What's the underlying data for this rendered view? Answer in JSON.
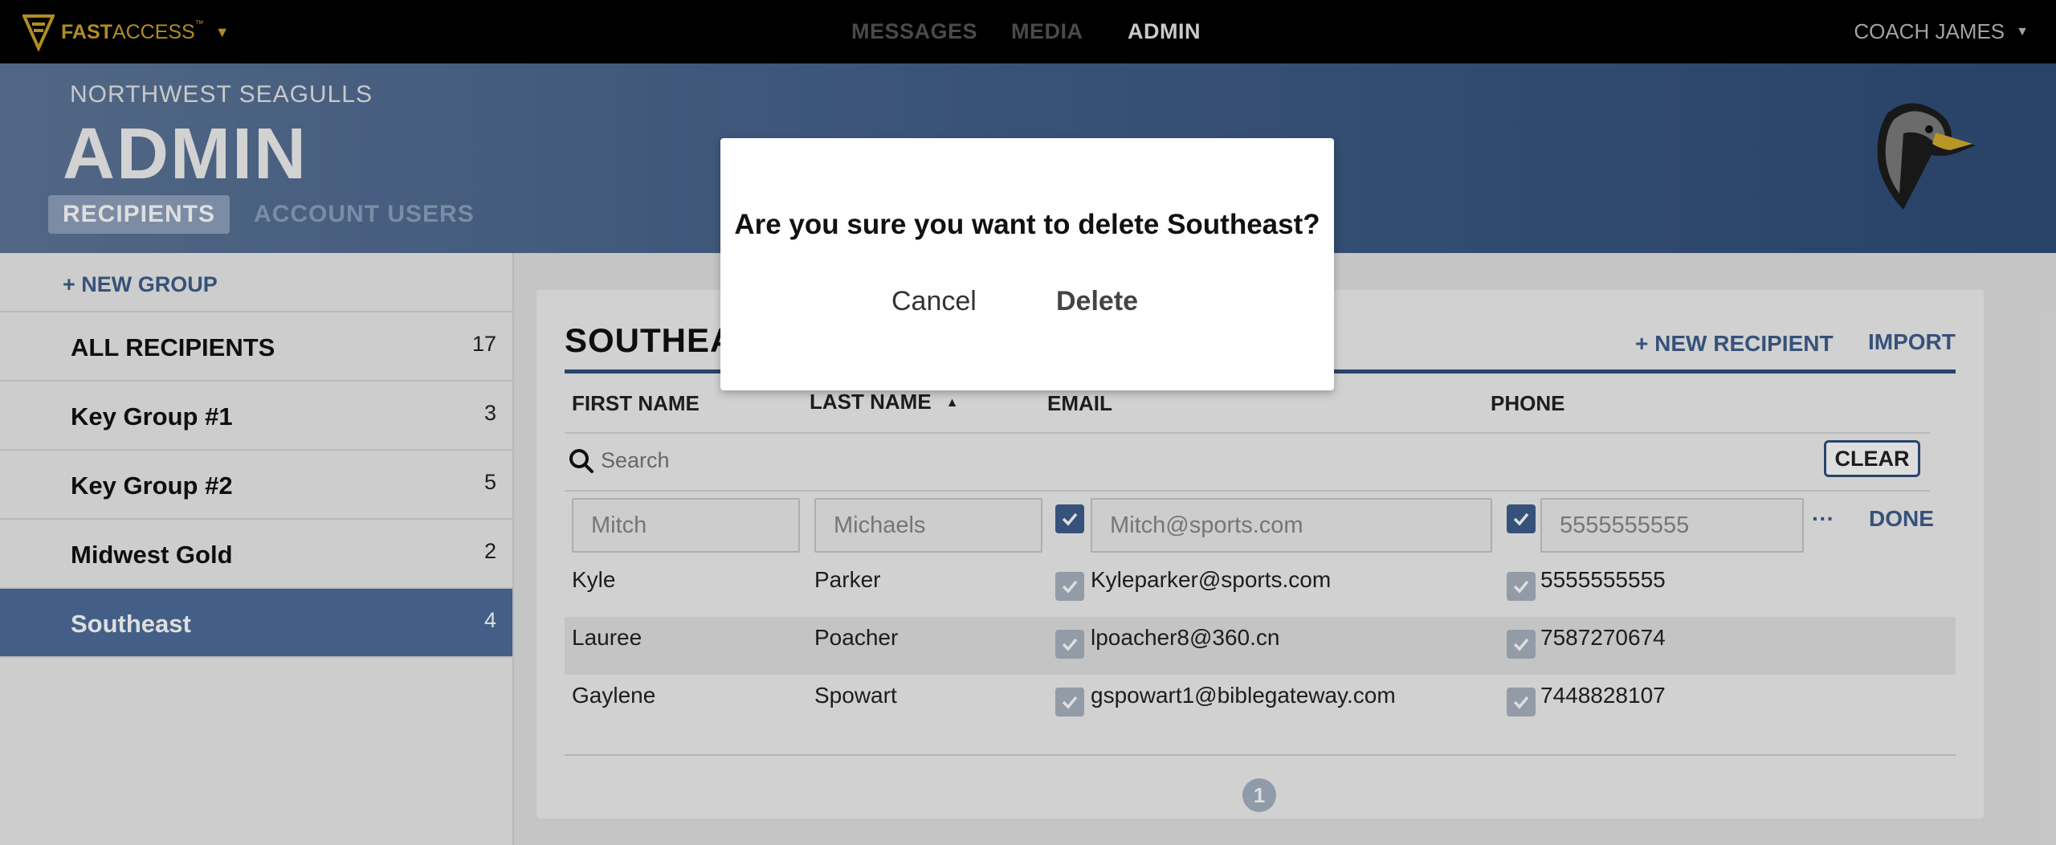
{
  "topbar": {
    "logo_bold": "FAST",
    "logo_light": "ACCESS",
    "logo_tm": "™",
    "nav": {
      "messages": "MESSAGES",
      "media": "MEDIA",
      "admin": "ADMIN"
    },
    "user": "COACH JAMES"
  },
  "header": {
    "org": "NORTHWEST SEAGULLS",
    "title": "ADMIN",
    "tabs": {
      "recipients": "RECIPIENTS",
      "account_users": "ACCOUNT USERS"
    }
  },
  "sidebar": {
    "new_group": "+ NEW GROUP",
    "groups": [
      {
        "name": "ALL RECIPIENTS",
        "count": "17"
      },
      {
        "name": "Key Group #1",
        "count": "3"
      },
      {
        "name": "Key Group #2",
        "count": "5"
      },
      {
        "name": "Midwest Gold",
        "count": "2"
      },
      {
        "name": "Southeast",
        "count": "4"
      }
    ]
  },
  "main": {
    "group_title": "SOUTHEAST",
    "new_recipient": "+ NEW RECIPIENT",
    "import": "IMPORT",
    "columns": {
      "first": "FIRST NAME",
      "last": "LAST NAME",
      "email": "EMAIL",
      "phone": "PHONE"
    },
    "search_placeholder": "Search",
    "clear": "CLEAR",
    "edit_row": {
      "first": "Mitch",
      "last": "Michaels",
      "email": "Mitch@sports.com",
      "phone": "5555555555",
      "more": "···",
      "done": "DONE"
    },
    "rows": [
      {
        "first": "Kyle",
        "last": "Parker",
        "email": "Kyleparker@sports.com",
        "phone": "5555555555"
      },
      {
        "first": "Lauree",
        "last": "Poacher",
        "email": "lpoacher8@360.cn",
        "phone": "7587270674"
      },
      {
        "first": "Gaylene",
        "last": "Spowart",
        "email": "gspowart1@biblegateway.com",
        "phone": "7448828107"
      }
    ],
    "page": "1"
  },
  "modal": {
    "message": "Are you sure you want to delete Southeast?",
    "cancel": "Cancel",
    "delete": "Delete"
  },
  "colors": {
    "accent": "#3f5f8e",
    "selected_group": "#4e6e9c",
    "logo_gold": "#c9a227"
  }
}
